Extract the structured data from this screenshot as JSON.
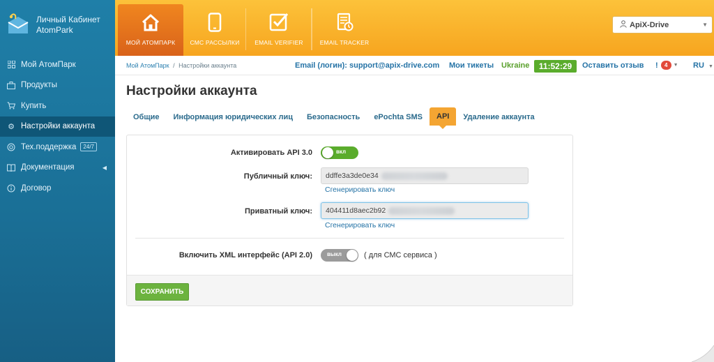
{
  "brand": {
    "line1": "Личный Кабинет",
    "line2": "AtomPark"
  },
  "sidebar": {
    "items": [
      {
        "label": "Мой АтомПарк",
        "icon": "grid-icon"
      },
      {
        "label": "Продукты",
        "icon": "briefcase-icon"
      },
      {
        "label": "Купить",
        "icon": "cart-icon"
      },
      {
        "label": "Настройки аккаунта",
        "icon": "gear-icon",
        "active": true
      },
      {
        "label": "Тех.поддержка",
        "icon": "lifebuoy-icon",
        "badge": "24/7"
      },
      {
        "label": "Документация",
        "icon": "book-icon"
      },
      {
        "label": "Договор",
        "icon": "info-icon"
      }
    ]
  },
  "topnav": {
    "tabs": [
      {
        "label": "МОЙ АТОМПАРК",
        "icon": "home-icon",
        "active": true
      },
      {
        "label": "СМС РАССЫЛКИ",
        "icon": "phone-icon"
      },
      {
        "label": "EMAIL VERIFIER",
        "icon": "checkbox-icon"
      },
      {
        "label": "EMAIL TRACKER",
        "icon": "tracker-icon"
      }
    ],
    "account_label": "ApiX-Drive"
  },
  "infobar": {
    "breadcrumb_home": "Мой АтомПарк",
    "breadcrumb_sep": "/",
    "breadcrumb_current": "Настройки аккаунта",
    "email_text": "Email (логин): support@apix-drive.com",
    "tickets": "Мои тикеты",
    "country": "Ukraine",
    "time": "11:52:29",
    "review": "Оставить отзыв",
    "alert_mark": "!",
    "alert_count": "4",
    "lang": "RU"
  },
  "page": {
    "title": "Настройки аккаунта",
    "tabs": [
      "Общие",
      "Информация юридических лиц",
      "Безопасность",
      "ePochta SMS",
      "API",
      "Удаление аккаунта"
    ],
    "active_tab": "API"
  },
  "api_form": {
    "activate_label": "Активировать API 3.0",
    "activate_toggle": "вкл",
    "public_key_label": "Публичный ключ:",
    "public_key_value": "ddffe3a3de0e34",
    "private_key_label": "Приватный ключ:",
    "private_key_value": "404411d8aec2b92",
    "generate_link": "Сгенерировать ключ",
    "xml_label": "Включить XML интерфейс (API 2.0)",
    "xml_toggle": "выкл",
    "xml_hint": "( для СМС сервиса )",
    "save_label": "СОХРАНИТЬ"
  },
  "colors": {
    "sidebar": "#1a6f96",
    "topbar": "#f7a51f",
    "active_top_tab": "#d9621a",
    "link": "#2573a6",
    "green": "#5aac2c",
    "active_tab": "#f4a532"
  }
}
